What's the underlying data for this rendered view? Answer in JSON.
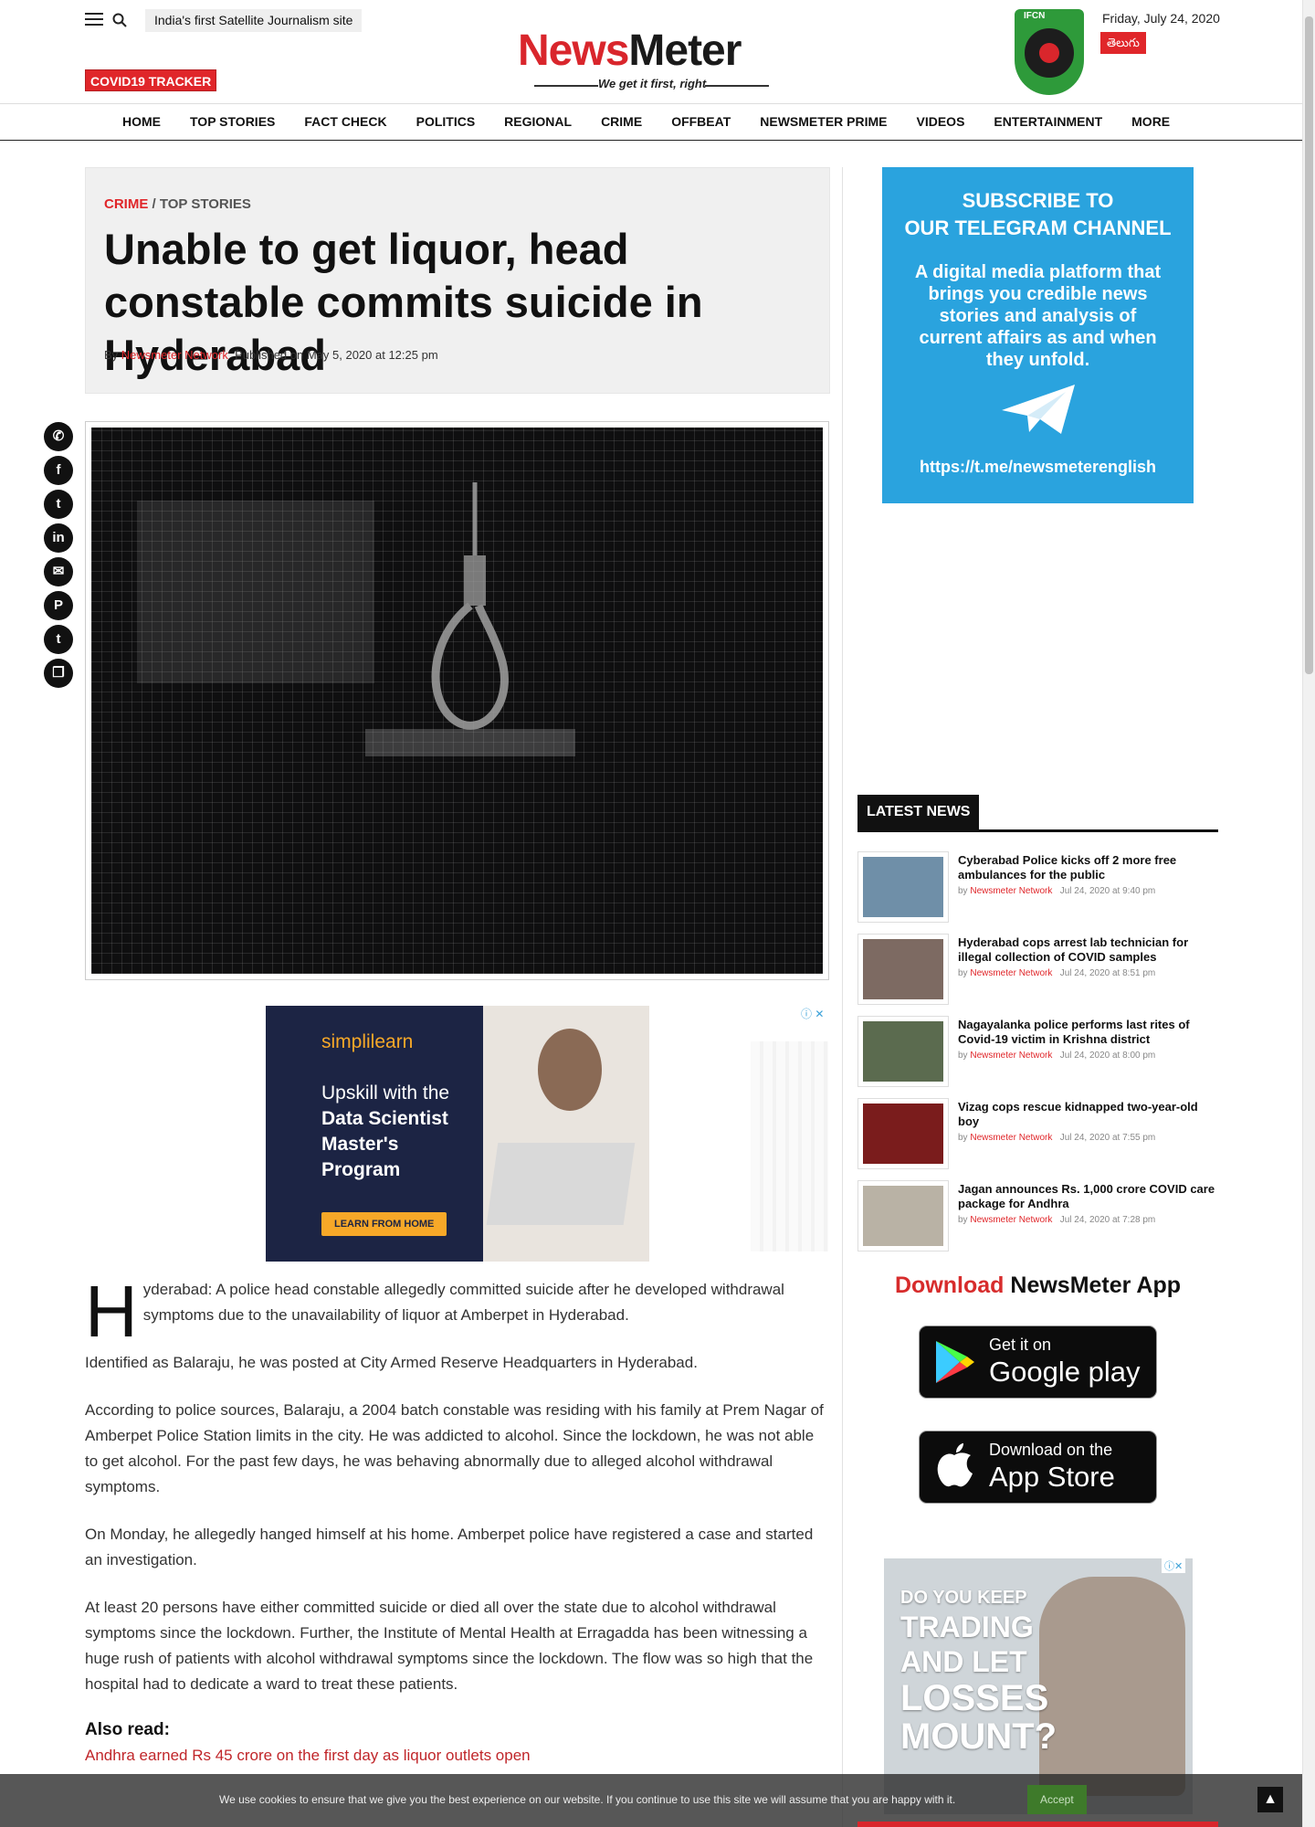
{
  "header": {
    "tagline": "India's first Satellite Journalism site",
    "covid_button": "COVID19 TRACKER",
    "logo_news": "News",
    "logo_meter": "Meter",
    "logo_slogan": "We get it first, right",
    "badge_text": "IFCN",
    "date": "Friday, July 24, 2020",
    "language_button": "తెలుగు"
  },
  "nav": [
    "HOME",
    "TOP STORIES",
    "FACT CHECK",
    "POLITICS",
    "REGIONAL",
    "CRIME",
    "OFFBEAT",
    "NEWSMETER PRIME",
    "VIDEOS",
    "ENTERTAINMENT",
    "MORE"
  ],
  "article": {
    "category": "CRIME",
    "category_sep": "/",
    "subcategory": "TOP STORIES",
    "title": "Unable to get liquor, head constable commits suicide in Hyderabad",
    "by_label": "By",
    "author": "Newsmeter Network",
    "published": "Published on May 5, 2020 at 12:25 pm",
    "dropcap": "H",
    "p1": "yderabad: A police head constable allegedly committed suicide after he developed withdrawal symptoms due to the unavailability of liquor at Amberpet in Hyderabad.",
    "p2": "Identified as Balaraju, he was posted at City Armed Reserve Headquarters in Hyderabad.",
    "p3": "According to police sources, Balaraju, a 2004 batch constable was residing with his family at Prem Nagar of Amberpet Police Station limits in the city. He was addicted to alcohol. Since the lockdown, he was not able to get alcohol. For the past few days, he was behaving abnormally due to alleged alcohol withdrawal symptoms.",
    "p4": "On Monday, he allegedly hanged himself at his home. Amberpet police have registered a case and started an investigation.",
    "p5": "At least 20 persons have either committed suicide or died all over the state due to alcohol withdrawal symptoms since the lockdown. Further, the Institute of Mental Health at Erragadda has been witnessing a huge rush of patients with alcohol withdrawal symptoms since the lockdown. The flow was so high that the hospital had to dedicate a ward to treat these patients.",
    "also_read": "Also read:",
    "related": "Andhra earned Rs 45 crore on the first day as liquor outlets open"
  },
  "share_icons": [
    "whatsapp-icon",
    "facebook-icon",
    "twitter-icon",
    "linkedin-icon",
    "email-icon",
    "pinterest-icon",
    "tumblr-icon",
    "copy-icon"
  ],
  "ad1": {
    "brand": "simplilearn",
    "line1": "Upskill with the",
    "line2": "Data Scientist",
    "line3": "Master's",
    "line4": "Program",
    "cta": "LEARN FROM HOME"
  },
  "telegram": {
    "heading1": "SUBSCRIBE TO",
    "heading2": "OUR TELEGRAM CHANNEL",
    "text": "A digital media platform that brings you credible news stories and analysis of current affairs as and when they unfold.",
    "url": "https://t.me/newsmeterenglish"
  },
  "latest": {
    "heading": "LATEST NEWS",
    "by": "by",
    "items": [
      {
        "title": "Cyberabad Police kicks off 2 more free ambulances for the public",
        "author": "Newsmeter Network",
        "time": "Jul 24, 2020 at 9:40 pm",
        "color": "#6f8fa8"
      },
      {
        "title": "Hyderabad cops arrest lab technician for illegal collection of COVID samples",
        "author": "Newsmeter Network",
        "time": "Jul 24, 2020 at 8:51 pm",
        "color": "#7d6a62"
      },
      {
        "title": "Nagayalanka police performs last rites of Covid-19 victim in Krishna district",
        "author": "Newsmeter Network",
        "time": "Jul 24, 2020 at 8:00 pm",
        "color": "#5b6b4f"
      },
      {
        "title": "Vizag cops rescue kidnapped two-year-old boy",
        "author": "Newsmeter Network",
        "time": "Jul 24, 2020 at 7:55 pm",
        "color": "#7a1c1c"
      },
      {
        "title": "Jagan announces Rs. 1,000 crore COVID care package for Andhra",
        "author": "Newsmeter Network",
        "time": "Jul 24, 2020 at 7:28 pm",
        "color": "#b9b2a5"
      }
    ]
  },
  "app": {
    "download": "Download",
    "name": "NewsMeter App",
    "gp_small": "Get it on",
    "gp_big": "Google play",
    "as_small": "Download on the",
    "as_big": "App Store"
  },
  "ad2": {
    "l1": "DO YOU KEEP",
    "l2": "TRADING",
    "l3": "AND LET",
    "l4": "LOSSES",
    "l5": "MOUNT?"
  },
  "cookie": {
    "message": "We use cookies to ensure that we give you the best experience on our website. If you continue to use this site we will assume that you are happy with it.",
    "accept": "Accept"
  }
}
